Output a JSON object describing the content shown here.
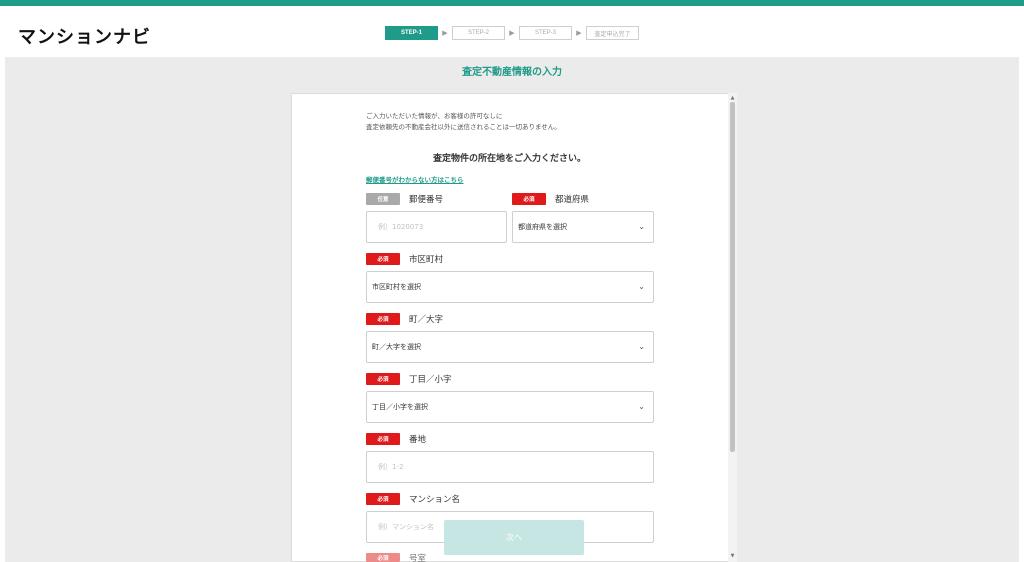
{
  "brand": {
    "logo": "マンションナビ",
    "accent": "#1f9b8a"
  },
  "steps": [
    {
      "label": "STEP-1",
      "active": true
    },
    {
      "label": "STEP-2",
      "active": false
    },
    {
      "label": "STEP-3",
      "active": false
    },
    {
      "label": "査定申込完了",
      "active": false
    }
  ],
  "page_title": "査定不動産情報の入力",
  "notice": {
    "line1": "ご入力いただいた情報が、お客様の許可なしに",
    "line2": "査定依頼先の不動産会社以外に送信されることは一切ありません。"
  },
  "section_title": "査定物件の所在地をご入力ください。",
  "zip_help_link": "郵便番号がわからない方はこちら",
  "badges": {
    "optional": "任意",
    "required": "必須"
  },
  "fields": {
    "postal": {
      "label": "郵便番号",
      "placeholder": "例）1020073"
    },
    "prefecture": {
      "label": "都道府県",
      "value": "都道府県を選択"
    },
    "city": {
      "label": "市区町村",
      "value": "市区町村を選択"
    },
    "town": {
      "label": "町／大字",
      "value": "町／大字を選択"
    },
    "chome": {
      "label": "丁目／小字",
      "value": "丁目／小字を選択"
    },
    "banchi": {
      "label": "番地",
      "placeholder": "例）1-2"
    },
    "mansion": {
      "label": "マンション名",
      "placeholder": "例）マンション名"
    },
    "next_label": "号室"
  },
  "next_button": "次へ"
}
